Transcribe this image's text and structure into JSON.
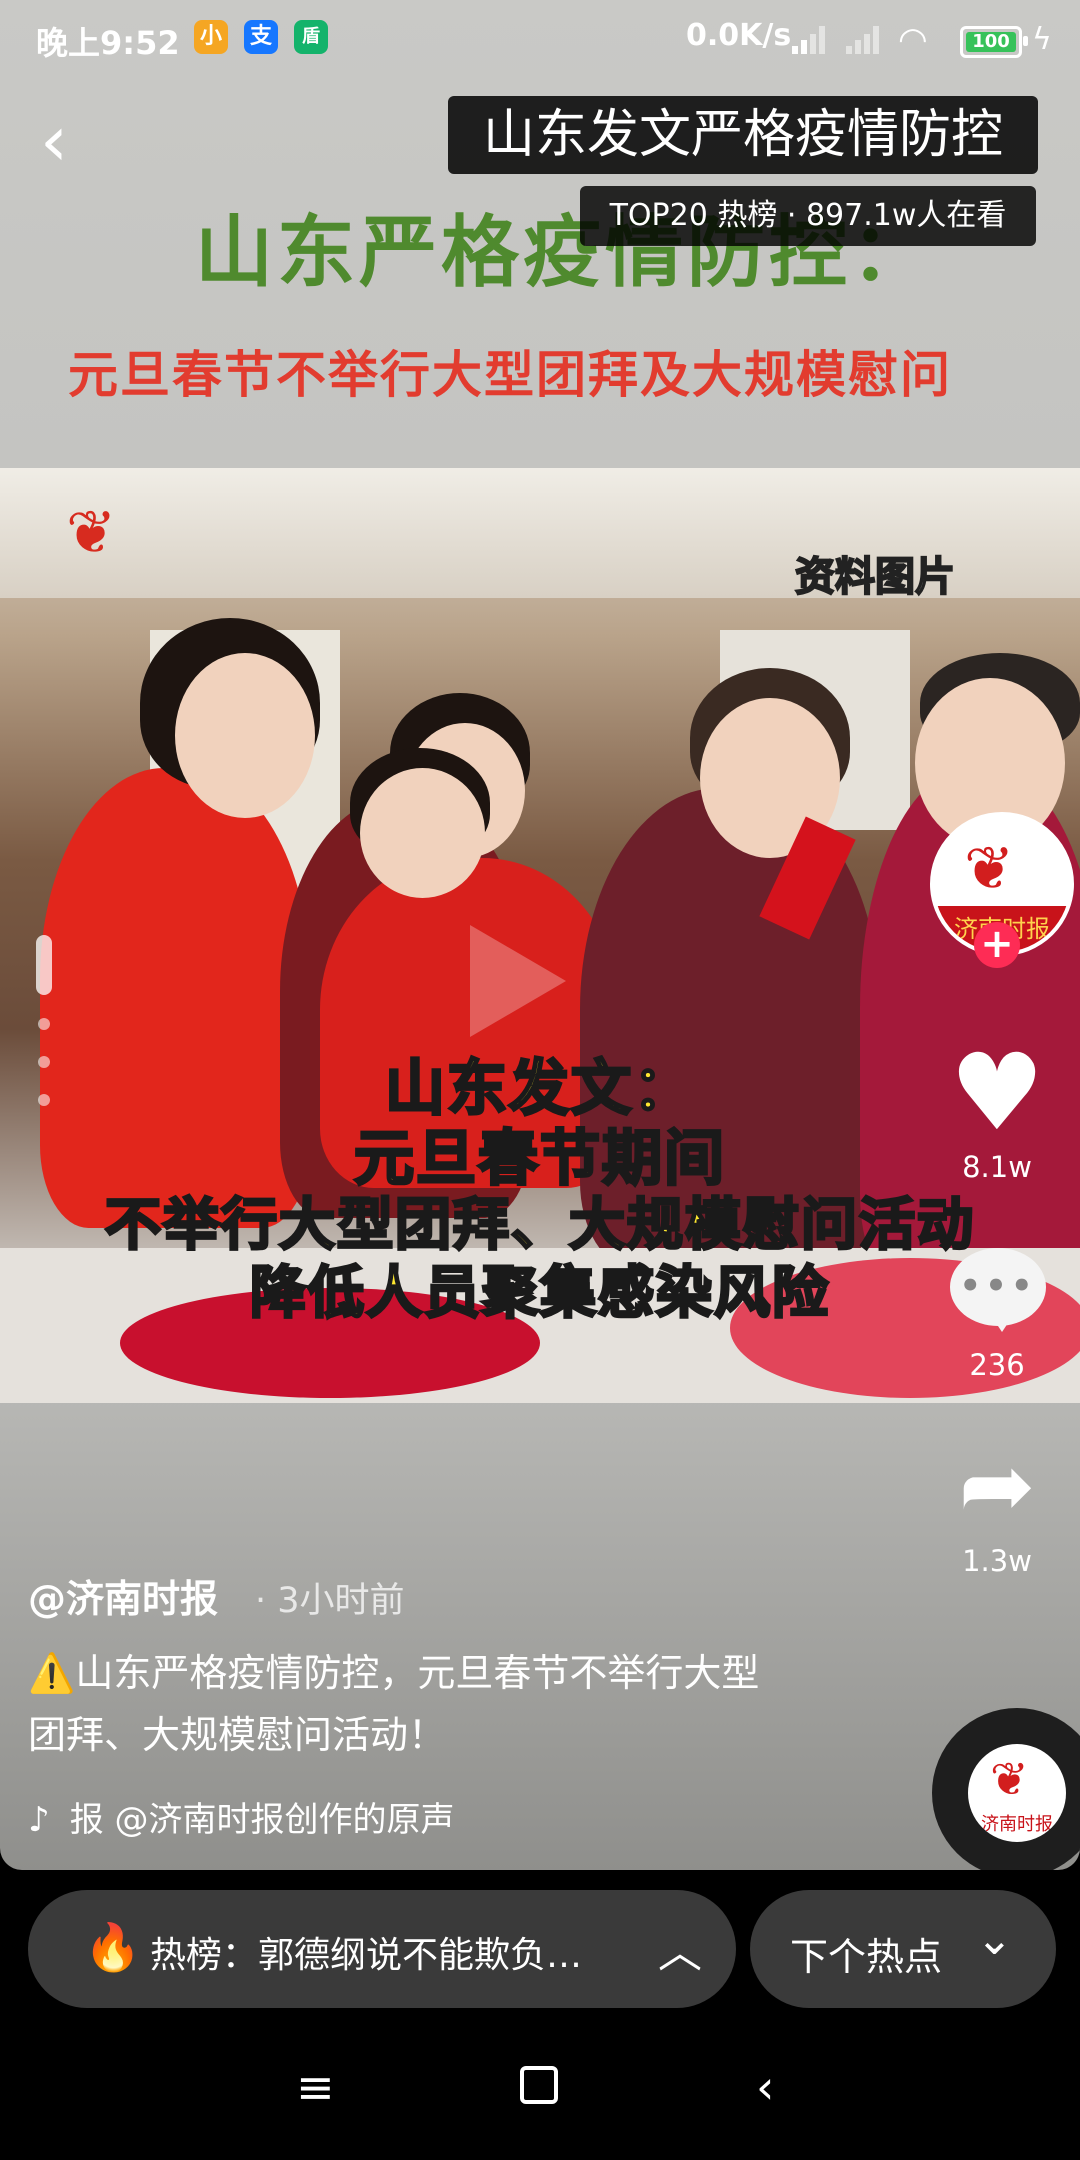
{
  "status_bar": {
    "time": "晚上9:52",
    "apps": [
      "小",
      "支",
      "盾"
    ],
    "net_speed": "0.0K/s",
    "battery": "100"
  },
  "video": {
    "topic_title": "山东发文严格疫情防控",
    "hot_badge": "TOP20 热榜 · 897.1w人在看",
    "headline_1": "山东严格疫情防控：",
    "headline_2": "元旦春节不举行大型团拜及大规模慰问",
    "photo_watermark": "资料图片",
    "caption_lines": [
      "山东发文：",
      "元旦春节期间",
      "不举行大型团拜、大规模慰问活动",
      "降低人员聚集感染风险"
    ]
  },
  "actions": {
    "likes": "8.1w",
    "comments": "236",
    "shares": "1.3w",
    "follow_label": "+",
    "avatar_text": "济南时报"
  },
  "post": {
    "author": "@济南时报",
    "time_ago": "3小时前",
    "description": "⚠️山东严格疫情防控，元旦春节不举行大型团拜、大规模慰问活动！",
    "music": "报  @济南时报创作的原声"
  },
  "bottom_bar": {
    "hot_list": "热榜：郭德纲说不能欺负…",
    "next_hot": "下个热点"
  },
  "icons": {
    "back": "back-arrow-icon",
    "like": "heart-icon",
    "comment": "comment-icon",
    "share": "share-icon",
    "fire": "fire-icon",
    "music": "tiktok-note-icon"
  },
  "colors": {
    "follow_accent": "#fe2c55",
    "caption_yellow": "#ffe930",
    "headline_green": "#4f8a2e",
    "headline_red": "#e23c2f"
  }
}
